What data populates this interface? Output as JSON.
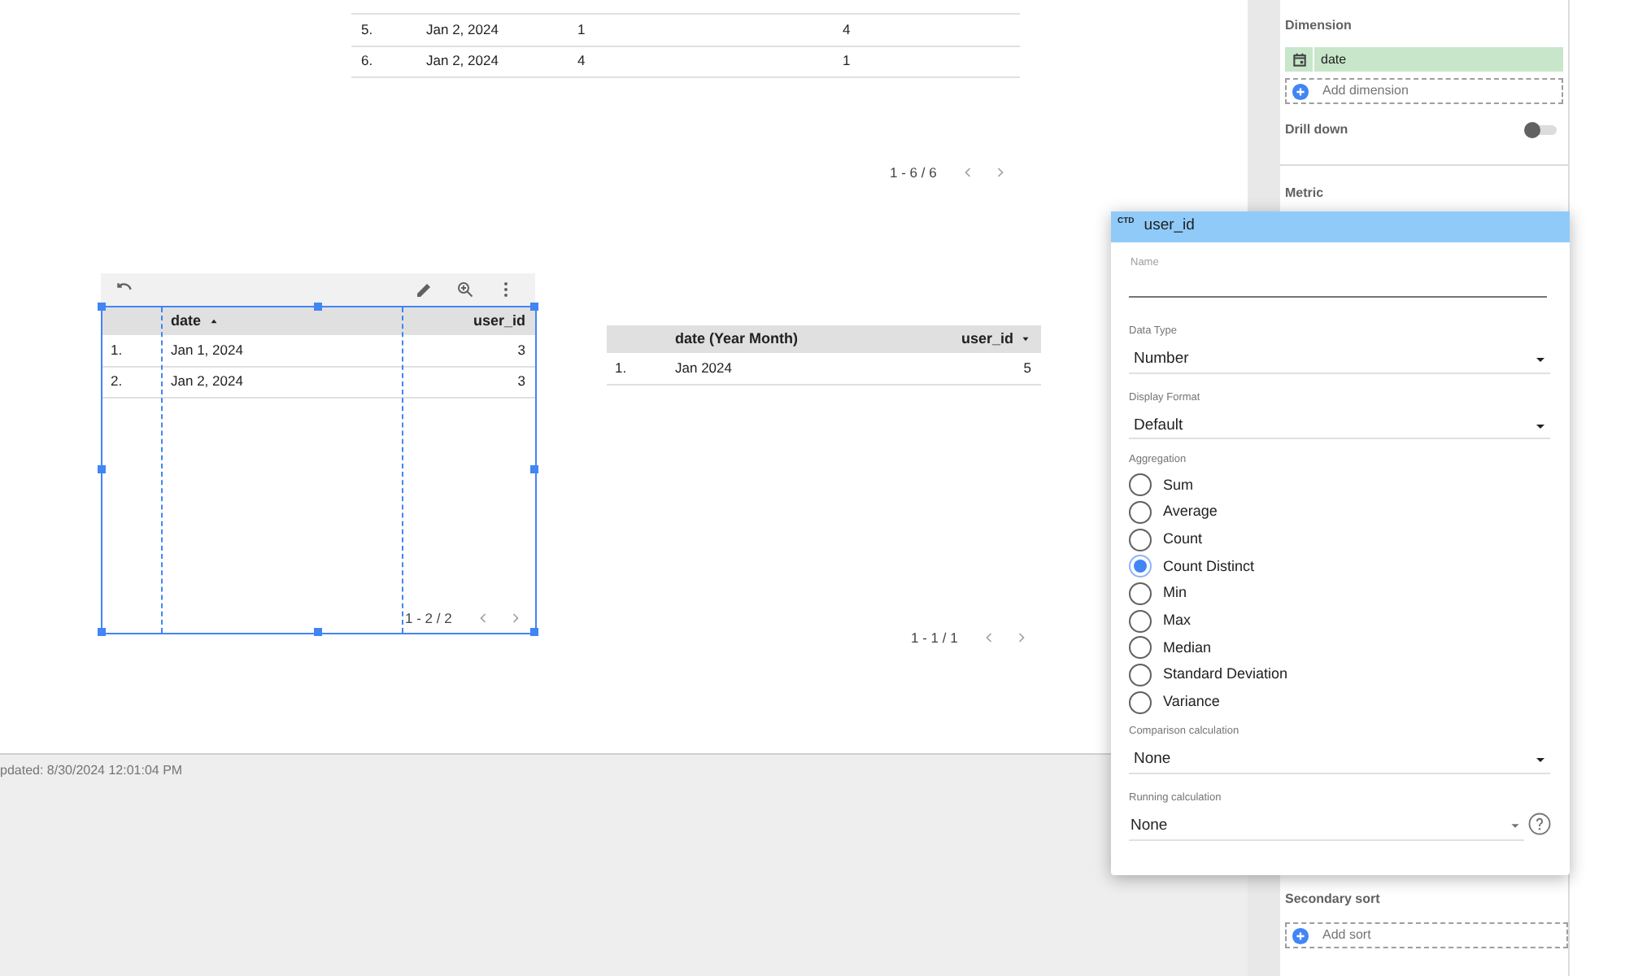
{
  "top_table": {
    "rows": [
      {
        "cells": [
          "5.",
          "Jan 2, 2024",
          "1",
          "4"
        ]
      },
      {
        "cells": [
          "6.",
          "Jan 2, 2024",
          "4",
          "1"
        ]
      }
    ],
    "pagination": "1 - 6 / 6"
  },
  "selected_table": {
    "selected": true,
    "columns": [
      {
        "label": "date",
        "sort_ascending": true,
        "sort_descending": false
      },
      {
        "label": "user_id",
        "sort_ascending": false,
        "sort_descending": false
      }
    ],
    "rows": [
      {
        "number": "1.",
        "cells": [
          "Jan 1, 2024",
          "3"
        ]
      },
      {
        "number": "2.",
        "cells": [
          "Jan 2, 2024",
          "3"
        ]
      }
    ],
    "pagination": "1 - 2 / 2"
  },
  "month_table": {
    "columns": [
      {
        "label": "date (Year Month)",
        "sort_ascending": false,
        "sort_descending": false
      },
      {
        "label": "user_id",
        "sort_ascending": false,
        "sort_descending": true
      }
    ],
    "rows": [
      {
        "number": "1.",
        "cells": [
          "Jan 2024",
          "5"
        ]
      }
    ],
    "pagination": "1 - 1 / 1"
  },
  "status_bar": {
    "text": "pdated: 8/30/2024 12:01:04 PM"
  },
  "panel": {
    "dimension_title": "Dimension",
    "dimension": "date",
    "add_dimension": "Add dimension",
    "drill_down": {
      "label": "Drill down",
      "on": false
    },
    "metric_title": "Metric",
    "secondary_sort_title": "Secondary sort",
    "add_sort": "Add sort"
  },
  "popup": {
    "type_badge": "CTD",
    "title": "user_id",
    "name_field": {
      "label": "Name"
    },
    "data_type": {
      "label": "Data Type",
      "value": "Number"
    },
    "display_format": {
      "label": "Display Format",
      "value": "Default"
    },
    "aggregation": {
      "label": "Aggregation",
      "options": [
        {
          "label": "Sum",
          "selected": false
        },
        {
          "label": "Average",
          "selected": false
        },
        {
          "label": "Count",
          "selected": false
        },
        {
          "label": "Count Distinct",
          "selected": true
        },
        {
          "label": "Min",
          "selected": false
        },
        {
          "label": "Max",
          "selected": false
        },
        {
          "label": "Median",
          "selected": false
        },
        {
          "label": "Standard Deviation",
          "selected": false
        },
        {
          "label": "Variance",
          "selected": false
        }
      ]
    },
    "comparison": {
      "label": "Comparison calculation",
      "value": "None"
    },
    "running": {
      "label": "Running calculation",
      "value": "None"
    }
  }
}
